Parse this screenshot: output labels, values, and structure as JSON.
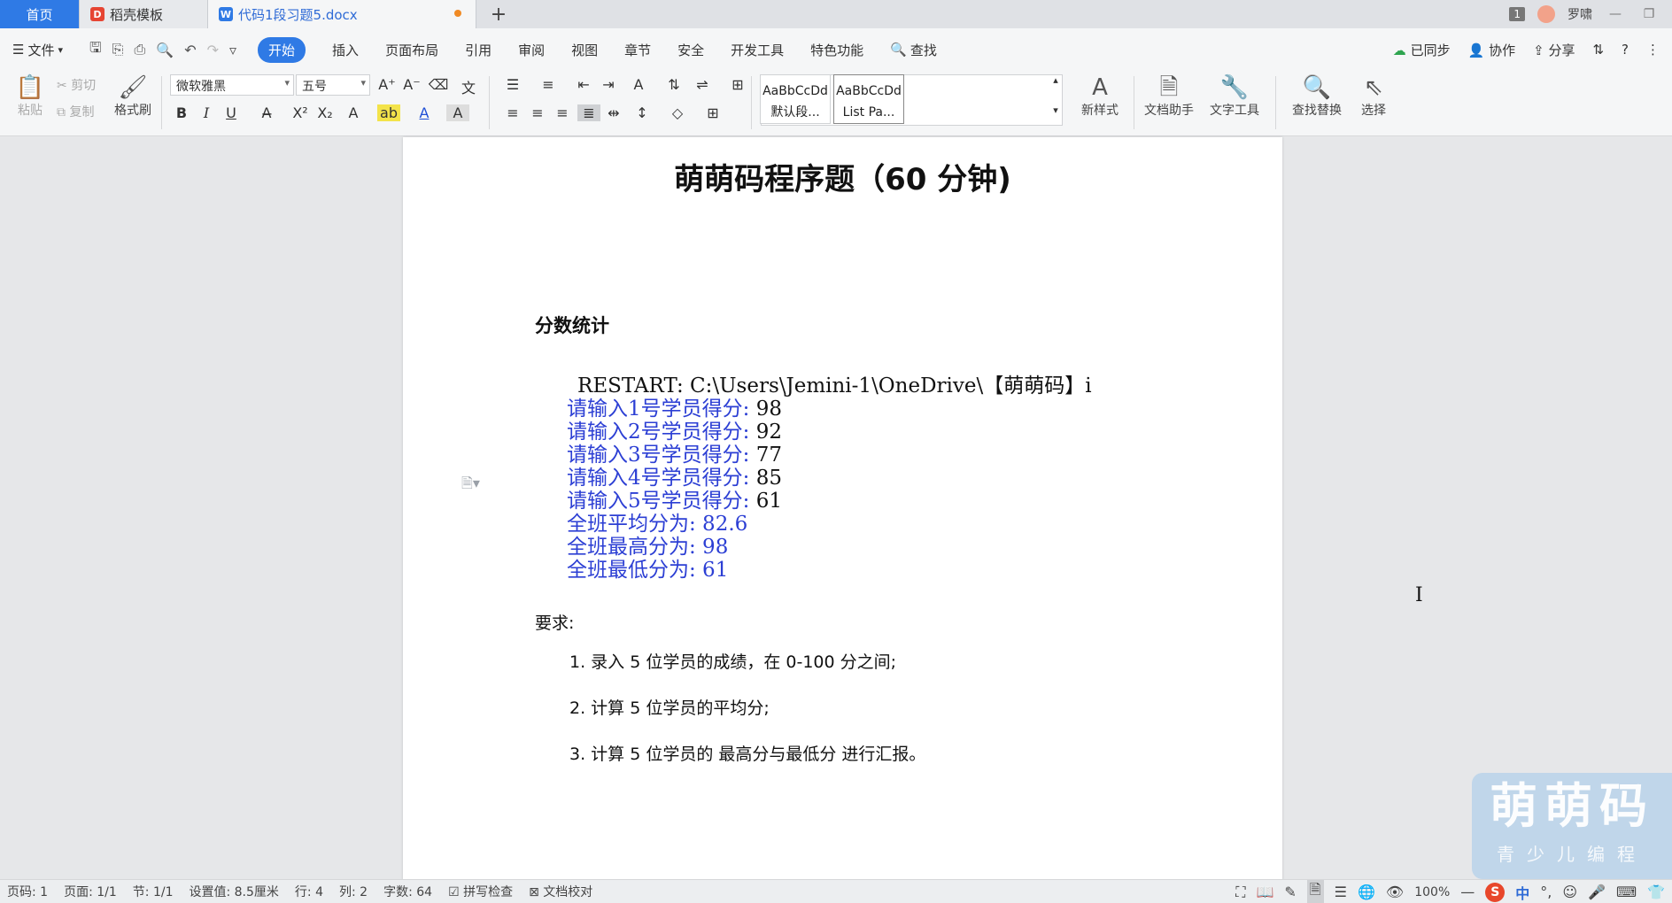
{
  "tabs": {
    "home": "首页",
    "template": "稻壳模板",
    "doc": "代码1段习题5.docx",
    "add": "+"
  },
  "titlebar_right": {
    "badge": "1",
    "user": "罗啸",
    "minimize": "—",
    "restore": "❐"
  },
  "menu": {
    "file": "文件",
    "start": "开始",
    "insert": "插入",
    "layout": "页面布局",
    "reference": "引用",
    "review": "审阅",
    "view": "视图",
    "section": "章节",
    "security": "安全",
    "dev": "开发工具",
    "special": "特色功能",
    "search": "查找",
    "sync": "已同步",
    "collab": "协作",
    "share": "分享"
  },
  "ribbon": {
    "paste": "粘贴",
    "cut": "剪切",
    "copy": "复制",
    "format_painter": "格式刷",
    "font_name": "微软雅黑",
    "font_size": "五号",
    "style1_sample": "AaBbCcDd",
    "style1_name": "默认段...",
    "style2_sample": "AaBbCcDd",
    "style2_name": "List Pa...",
    "new_style": "新样式",
    "doc_assistant": "文档助手",
    "text_tools": "文字工具",
    "find_replace": "查找替换",
    "select": "选择"
  },
  "document": {
    "title": "萌萌码程序题（60 分钟)",
    "heading": "分数统计",
    "console": {
      "restart": "RESTART: C:\\Users\\Jemini-1\\OneDrive\\【萌萌码】i",
      "inputs": [
        {
          "prompt": "请输入1号学员得分:",
          "value": "98"
        },
        {
          "prompt": "请输入2号学员得分:",
          "value": "92"
        },
        {
          "prompt": "请输入3号学员得分:",
          "value": "77"
        },
        {
          "prompt": "请输入4号学员得分:",
          "value": "85"
        },
        {
          "prompt": "请输入5号学员得分:",
          "value": "61"
        }
      ],
      "results": [
        "全班平均分为:  82.6",
        "全班最高分为:  98",
        "全班最低分为:  61"
      ]
    },
    "requirements_label": "要求:",
    "requirements": [
      "1.  录入 5 位学员的成绩，在 0-100 分之间;",
      "2.  计算 5 位学员的平均分;",
      "3.  计算 5 位学员的  最高分与最低分  进行汇报。"
    ]
  },
  "watermark": {
    "main": "萌萌码",
    "sub": "青少儿编程"
  },
  "status": {
    "page_code": "页码: 1",
    "page": "页面: 1/1",
    "section": "节: 1/1",
    "setting": "设置值: 8.5厘米",
    "row": "行: 4",
    "col": "列: 2",
    "word_count": "字数: 64",
    "spell_check": "拼写检查",
    "doc_proof": "文档校对",
    "zoom": "100%",
    "ime_lang": "中"
  }
}
